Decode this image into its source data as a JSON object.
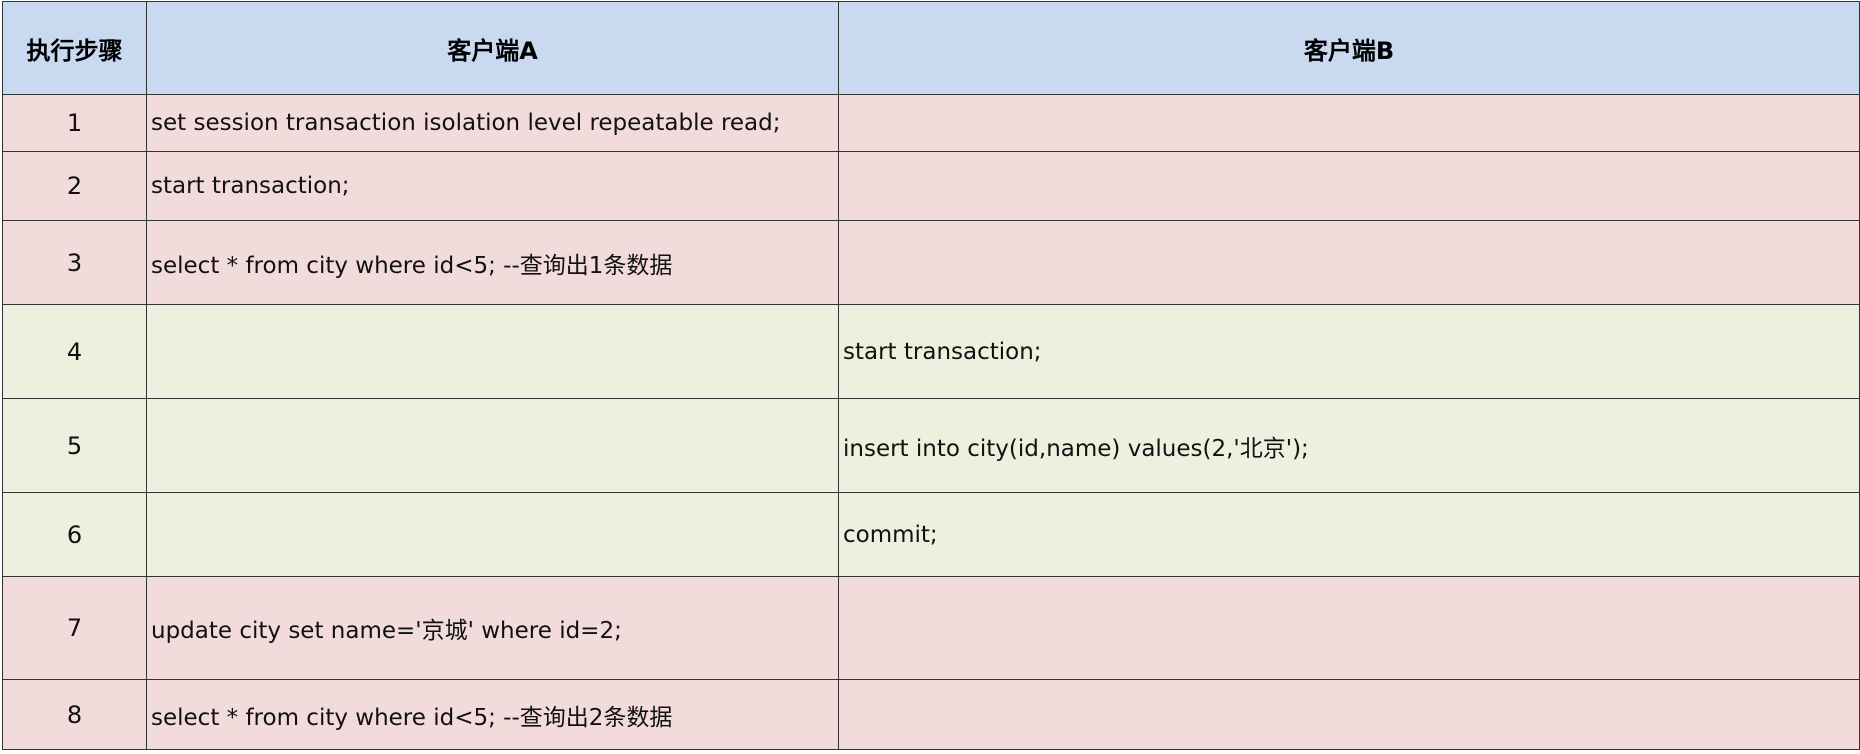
{
  "header": {
    "step": "执行步骤",
    "client_a": "客户端A",
    "client_b": "客户端B"
  },
  "rows": [
    {
      "step": "1",
      "a": "set session transaction isolation level repeatable read;",
      "b": "",
      "client": "A",
      "color": "#f2dcdb"
    },
    {
      "step": "2",
      "a": "start transaction;",
      "b": "",
      "client": "A",
      "color": "#f2dcdb"
    },
    {
      "step": "3",
      "a": "select * from city where id<5; --查询出1条数据",
      "b": "",
      "client": "A",
      "color": "#f2dcdb"
    },
    {
      "step": "4",
      "a": "",
      "b": "start transaction;",
      "client": "B",
      "color": "#ebf1de"
    },
    {
      "step": "5",
      "a": "",
      "b": "insert into city(id,name) values(2,'北京');",
      "client": "B",
      "color": "#ebf1de"
    },
    {
      "step": "6",
      "a": "",
      "b": "commit;",
      "client": "B",
      "color": "#ebf1de"
    },
    {
      "step": "7",
      "a": "update city set name='京城' where id=2;",
      "b": "",
      "client": "A",
      "color": "#f2dcdb"
    },
    {
      "step": "8",
      "a": "select * from city where id<5; --查询出2条数据",
      "b": "",
      "client": "A",
      "color": "#f2dcdb"
    }
  ],
  "colors": {
    "header_bg": "#c9d9f0",
    "client_a_row": "#f2dcdb",
    "client_b_row": "#ebf1de",
    "border": "#333333"
  }
}
